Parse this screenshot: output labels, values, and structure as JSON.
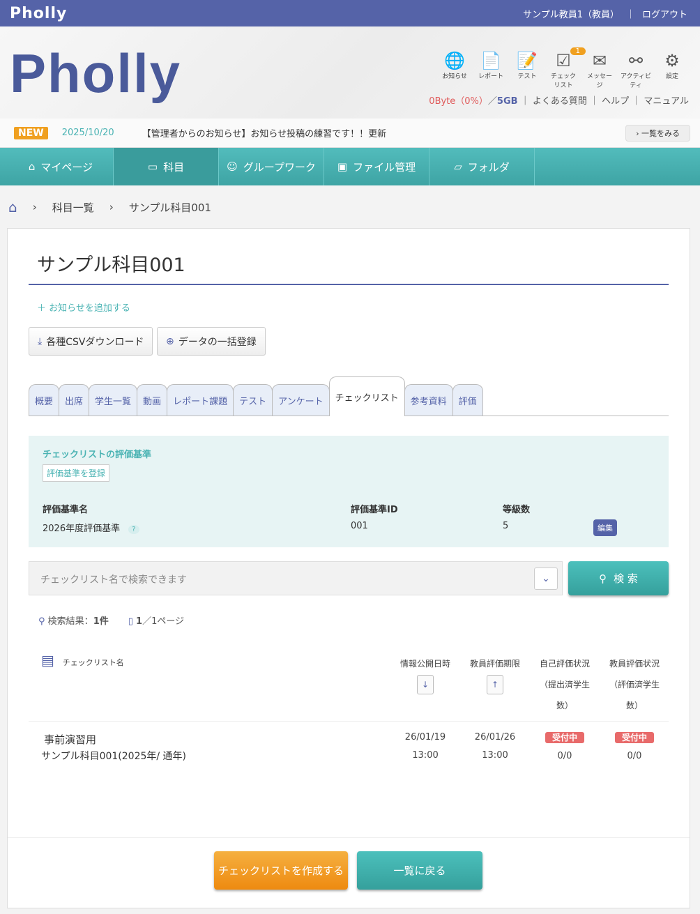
{
  "topbar": {
    "brand": "Pholly",
    "user": "サンプル教員1（教員）",
    "sep": "｜",
    "logout": "ログアウト"
  },
  "header": {
    "logo": "Pholly",
    "icons": [
      {
        "name": "globe",
        "label": "お知らせ",
        "g": "🌐"
      },
      {
        "name": "report",
        "label": "レポート",
        "g": "📄"
      },
      {
        "name": "test",
        "label": "テスト",
        "g": "📝"
      },
      {
        "name": "checklist",
        "label": "チェックリスト",
        "g": "☑",
        "badge": "1"
      },
      {
        "name": "message",
        "label": "メッセージ",
        "g": "✉"
      },
      {
        "name": "activity",
        "label": "アクティビティ",
        "g": "⚯"
      },
      {
        "name": "settings",
        "label": "設定",
        "g": "⚙"
      }
    ],
    "storage_used": "0Byte（0%）",
    "storage_sep": "／",
    "storage_total": "5GB",
    "faq": "よくある質問",
    "help": "ヘルプ",
    "manual": "マニュアル"
  },
  "news": {
    "badge": "NEW",
    "date": "2025/10/20",
    "text": "【管理者からのお知らせ】お知らせ投稿の練習です！！更新",
    "more": "一覧をみる"
  },
  "nav": [
    {
      "label": "マイページ",
      "g": "⌂"
    },
    {
      "label": "科目",
      "g": "▭"
    },
    {
      "label": "グループワーク",
      "g": "☺"
    },
    {
      "label": "ファイル管理",
      "g": "▣"
    },
    {
      "label": "フォルダ",
      "g": "▱"
    }
  ],
  "breadcrumb": [
    "科目一覧",
    "サンプル科目001"
  ],
  "page": {
    "title": "サンプル科目001",
    "add_notice": "お知らせを追加する",
    "csv": "各種CSVダウンロード",
    "bulk": "データの一括登録"
  },
  "tabs": [
    "概要",
    "出席",
    "学生一覧",
    "動画",
    "レポート課題",
    "テスト",
    "アンケート",
    "チェックリスト",
    "参考資料",
    "評価"
  ],
  "criteria": {
    "heading": "チェックリストの評価基準",
    "register": "評価基準を登録",
    "h_name": "評価基準名",
    "h_id": "評価基準ID",
    "h_grades": "等級数",
    "name": "2026年度評価基準",
    "id": "001",
    "grades": "5",
    "edit": "編集"
  },
  "search": {
    "placeholder": "チェックリスト名で検索できます",
    "button": "検 索",
    "result_label": "検索結果：",
    "result_count": "1件",
    "page": "1",
    "page_total": "／1ページ"
  },
  "table": {
    "headers": [
      "チェックリスト名",
      "情報公開日時",
      "教員評価期限",
      "自己評価状況",
      "（提出済学生",
      "数）",
      "教員評価状況",
      "（評価済学生",
      "数）"
    ],
    "rows": [
      {
        "name": "事前演習用",
        "course": "サンプル科目001(2025年/ 通年)",
        "pub_date": "26/01/19",
        "pub_time": "13:00",
        "due_date": "26/01/26",
        "due_time": "13:00",
        "self_status": "受付中",
        "self_count": "0/0",
        "teacher_status": "受付中",
        "teacher_count": "0/0"
      }
    ]
  },
  "footer": {
    "create": "チェックリストを作成する",
    "back": "一覧に戻る"
  }
}
